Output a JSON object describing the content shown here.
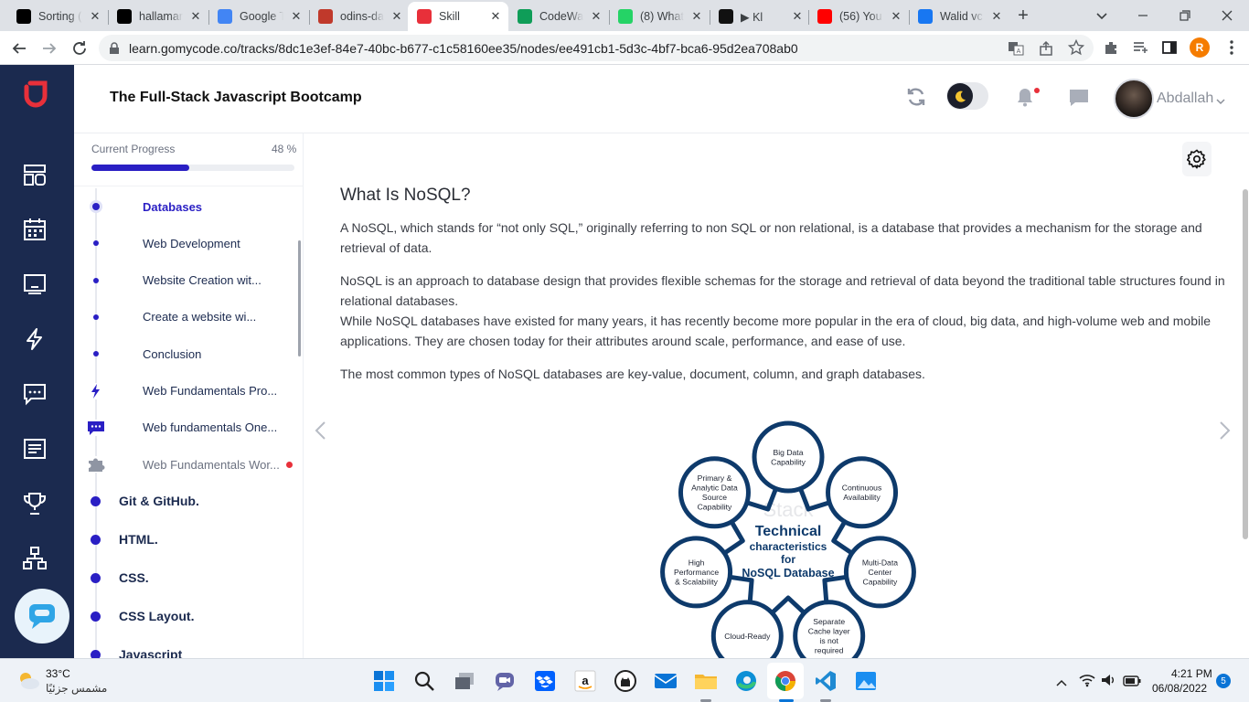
{
  "browser": {
    "tabs": [
      {
        "title": "Sorting (",
        "favicon": "va-icon",
        "color": "#000000"
      },
      {
        "title": "hallamar",
        "favicon": "github-icon",
        "color": "#000000"
      },
      {
        "title": "Google T",
        "favicon": "google-translate-icon",
        "color": "#4285f4"
      },
      {
        "title": "odins-da",
        "favicon": "odin-icon",
        "color": "#c0392b"
      },
      {
        "title": "Skill",
        "favicon": "gomycode-icon",
        "color": "#e8303a",
        "active": true
      },
      {
        "title": "CodeWa",
        "favicon": "sheets-icon",
        "color": "#0f9d58"
      },
      {
        "title": "(8) What",
        "favicon": "whatsapp-icon",
        "color": "#25d366"
      },
      {
        "title": "▶ Kl",
        "favicon": "music-icon",
        "color": "#111111"
      },
      {
        "title": "(56) You",
        "favicon": "youtube-icon",
        "color": "#ff0000"
      },
      {
        "title": "Walid vc",
        "favicon": "facebook-icon",
        "color": "#1877f2"
      }
    ],
    "url": "learn.gomycode.co/tracks/8dc1e3ef-84e7-40bc-b677-c1c58160ee35/nodes/ee491cb1-5d3c-4bf7-bca6-95d2ea708ab0",
    "profile_initial": "R"
  },
  "app": {
    "course_title": "The Full-Stack Javascript Bootcamp",
    "user_name": "Abdallah",
    "brand_color": "#e8303a",
    "nav_color": "#1b2a4f"
  },
  "progress": {
    "label": "Current Progress",
    "percent_text": "48 %",
    "value": 0.48
  },
  "toc": {
    "items": [
      {
        "label": "Databases",
        "type": "dot",
        "active": true
      },
      {
        "label": "Web Development",
        "type": "dot"
      },
      {
        "label": "Website Creation wit...",
        "type": "dot"
      },
      {
        "label": "Create a website wi...",
        "type": "dot"
      },
      {
        "label": "Conclusion",
        "type": "dot"
      },
      {
        "label": "Web Fundamentals Pro...",
        "type": "bolt"
      },
      {
        "label": "Web fundamentals One...",
        "type": "chat"
      },
      {
        "label": "Web Fundamentals Wor...",
        "type": "puzzle",
        "dimmed": true,
        "badge": true
      }
    ],
    "sections": [
      {
        "label": "Git & GitHub."
      },
      {
        "label": "HTML."
      },
      {
        "label": "CSS."
      },
      {
        "label": "CSS Layout."
      },
      {
        "label": "Javascript"
      }
    ]
  },
  "article": {
    "title": "What Is NoSQL?",
    "p1": "A NoSQL, which stands for “not only SQL,” originally referring to non SQL or non relational, is a database that provides a mechanism for the storage and retrieval of data.",
    "p2": "NoSQL is an approach to database design that provides flexible schemas for the storage and retrieval of data beyond the traditional table structures found in relational databases.",
    "p3": "While NoSQL databases have existed for many years, it has recently become more popular in the era of cloud, big data, and high-volume web and mobile applications. They are chosen today for their attributes around scale, performance, and ease of use.",
    "p4": "The most common types of NoSQL databases are key-value, document, column, and graph databases."
  },
  "diagram": {
    "center": [
      "Technical",
      "characteristics",
      "for",
      "NoSQL Database"
    ],
    "watermark": "Stack",
    "nodes": [
      {
        "lines": [
          "Big Data",
          "Capability"
        ]
      },
      {
        "lines": [
          "Continuous",
          "Availability"
        ]
      },
      {
        "lines": [
          "Multi-Data",
          "Center",
          "Capability"
        ]
      },
      {
        "lines": [
          "Separate",
          "Cache layer",
          "is not",
          "required"
        ]
      },
      {
        "lines": [
          "Cloud-Ready"
        ]
      },
      {
        "lines": [
          "High",
          "Performance",
          "& Scalability"
        ]
      },
      {
        "lines": [
          "Primary &",
          "Analytic Data",
          "Source",
          "Capability"
        ]
      }
    ]
  },
  "taskbar": {
    "temperature": "33°C",
    "weather": "مشمس جزئيًا",
    "time": "4:21 PM",
    "date": "06/08/2022",
    "notifications": "5"
  }
}
